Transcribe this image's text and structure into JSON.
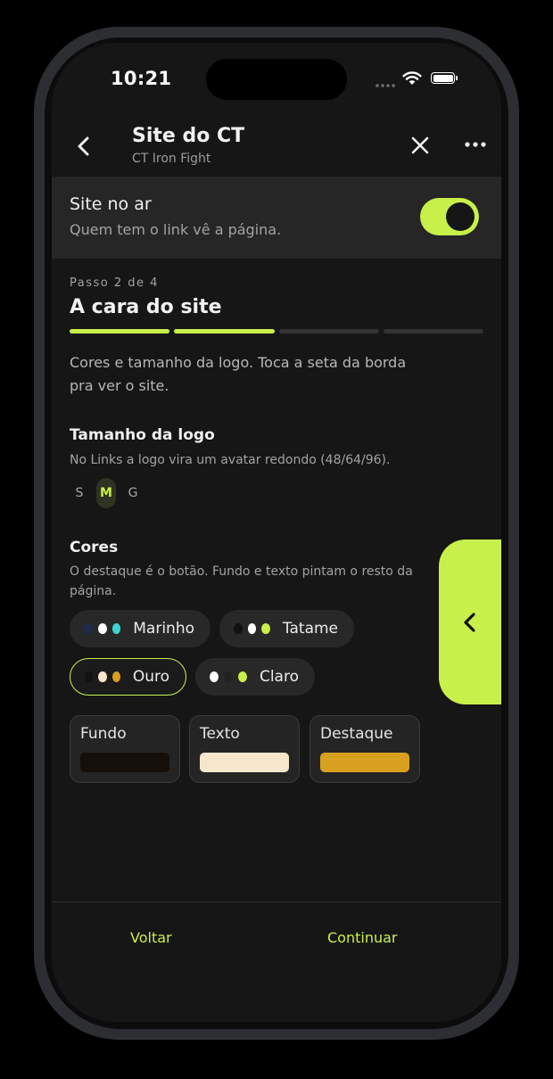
{
  "status": {
    "time": "10:21"
  },
  "header": {
    "title": "Site do CT",
    "subtitle": "CT Iron Fight"
  },
  "live": {
    "title": "Site no ar",
    "subtitle": "Quem tem o link vê a página.",
    "enabled": true
  },
  "step": {
    "label": "Passo 2 de 4",
    "title": "A cara do site",
    "current": 2,
    "total": 4
  },
  "intro": "Cores e tamanho da logo. Toca a seta da borda pra ver o site.",
  "logo_size": {
    "title": "Tamanho da logo",
    "desc": "No Links a logo vira um avatar redondo (48/64/96).",
    "options": [
      "S",
      "M",
      "G"
    ],
    "selected": "M"
  },
  "colors": {
    "title": "Cores",
    "desc": "O destaque é o botão. Fundo e texto pintam o resto da página.",
    "themes": [
      {
        "label": "Marinho",
        "dots": [
          "#1c2b4a",
          "#ffffff",
          "#3dd6d0"
        ]
      },
      {
        "label": "Tatame",
        "dots": [
          "#111111",
          "#ffffff",
          "#c8f04a"
        ]
      },
      {
        "label": "Ouro",
        "dots": [
          "#111111",
          "#f5e6cc",
          "#d9a01f"
        ],
        "selected": true
      },
      {
        "label": "Claro",
        "dots": [
          "#ffffff",
          "#222222",
          "#c8f04a"
        ]
      }
    ],
    "swatches": [
      {
        "label": "Fundo",
        "color": "#140f0a"
      },
      {
        "label": "Texto",
        "color": "#f5e6cc"
      },
      {
        "label": "Destaque",
        "color": "#d9a01f"
      }
    ]
  },
  "footer": {
    "back": "Voltar",
    "next": "Continuar"
  },
  "accent": "#c8f04a"
}
